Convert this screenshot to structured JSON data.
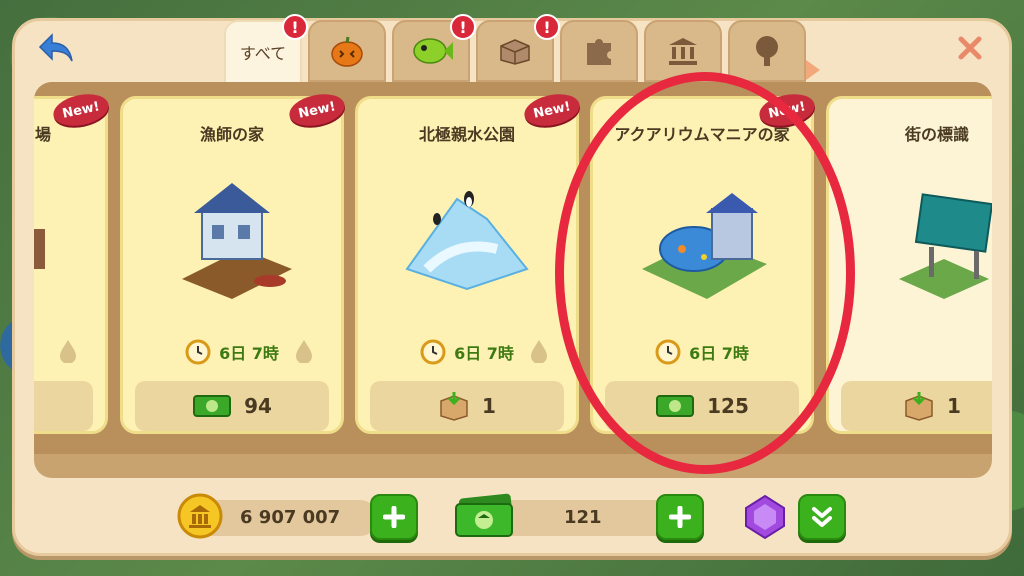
{
  "header": {
    "back_icon": "back-arrow-icon",
    "close_icon": "close-x-icon"
  },
  "tabs": [
    {
      "label": "すべて",
      "icon": "all",
      "badge": "!",
      "active": true
    },
    {
      "label": "",
      "icon": "pumpkin-icon",
      "badge": ""
    },
    {
      "label": "",
      "icon": "fish-icon",
      "badge": "!"
    },
    {
      "label": "",
      "icon": "box-icon",
      "badge": "!"
    },
    {
      "label": "",
      "icon": "puzzle-icon",
      "badge": ""
    },
    {
      "label": "",
      "icon": "bank-icon",
      "badge": ""
    },
    {
      "label": "",
      "icon": "tree-icon",
      "badge": ""
    }
  ],
  "cards": [
    {
      "name": "場",
      "new": "New!",
      "time": "",
      "price": "",
      "price_icon": "cash-icon"
    },
    {
      "name": "漁師の家",
      "new": "New!",
      "time": "6日 7時",
      "price": "94",
      "price_icon": "cash-icon"
    },
    {
      "name": "北極親水公園",
      "new": "New!",
      "time": "6日 7時",
      "price": "1",
      "price_icon": "crate-icon"
    },
    {
      "name": "アクアリウムマニアの家",
      "new": "New!",
      "time": "6日 7時",
      "price": "125",
      "price_icon": "cash-icon"
    },
    {
      "name": "街の標識",
      "new": "",
      "time": "",
      "price": "1",
      "price_icon": "crate-icon"
    }
  ],
  "resources": {
    "coins": "6 907 007",
    "cash": "121"
  },
  "colors": {
    "highlight": "#e8283e",
    "accent_green": "#3cb11e"
  }
}
